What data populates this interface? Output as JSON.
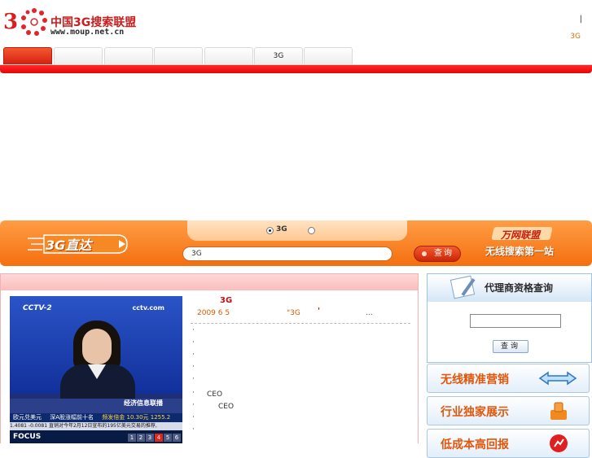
{
  "header": {
    "logo_numeral": "3",
    "logo_title": "中国3G搜索联盟",
    "logo_url": "www.moup.net.cn",
    "top_right_separator": "|",
    "top_right_link": "3G"
  },
  "nav": {
    "tabs": [
      {
        "label": ""
      },
      {
        "label": ""
      },
      {
        "label": ""
      },
      {
        "label": ""
      },
      {
        "label": ""
      },
      {
        "label": "3G"
      },
      {
        "label": ""
      }
    ],
    "active_index": 0,
    "accent_color": "#ee1010"
  },
  "search_band": {
    "title": "3G直达",
    "radio_options": [
      {
        "label": "3G",
        "selected": true
      },
      {
        "label": "",
        "selected": false
      }
    ],
    "input_value": "3G",
    "search_button": "查询",
    "brand": "万网联盟",
    "slogan": "无线搜索第一站"
  },
  "news": {
    "image": {
      "channel_logo": "CCTV-2",
      "site_logo": "cctv.com",
      "program_caption": "经济信息联播",
      "ticker_items": [
        "欧元兑美元",
        "深A股涨幅前十名",
        "频发倍金 10.30元 1255.2"
      ],
      "ticker_line2": "1.4081 -0.0081 直销对今年2月12日宣布的195亿美元交易的推荐,",
      "focus_label": "FOCUS",
      "pages": [
        "1",
        "2",
        "3",
        "4",
        "5",
        "6"
      ],
      "current_page": "4"
    },
    "headline": "3G",
    "date": "2009 6 5",
    "summary_prefix": "\"3G",
    "summary_mark": "'",
    "more": "...",
    "bullets": [
      "·",
      "·",
      "·",
      "·",
      "·",
      "·",
      "·",
      "·",
      "·"
    ],
    "bullet_texts": [
      "",
      "",
      "",
      "",
      "",
      "CEO",
      "CEO",
      "",
      ""
    ]
  },
  "sidebar": {
    "agent_query_title": "代理商资格查询",
    "agent_query_button": "查询",
    "banners": [
      {
        "label": "无线精准营销",
        "icon": "double-arrow-icon"
      },
      {
        "label": "行业独家展示",
        "icon": "box-icon"
      },
      {
        "label": "低成本高回报",
        "icon": "chart-icon"
      }
    ]
  }
}
